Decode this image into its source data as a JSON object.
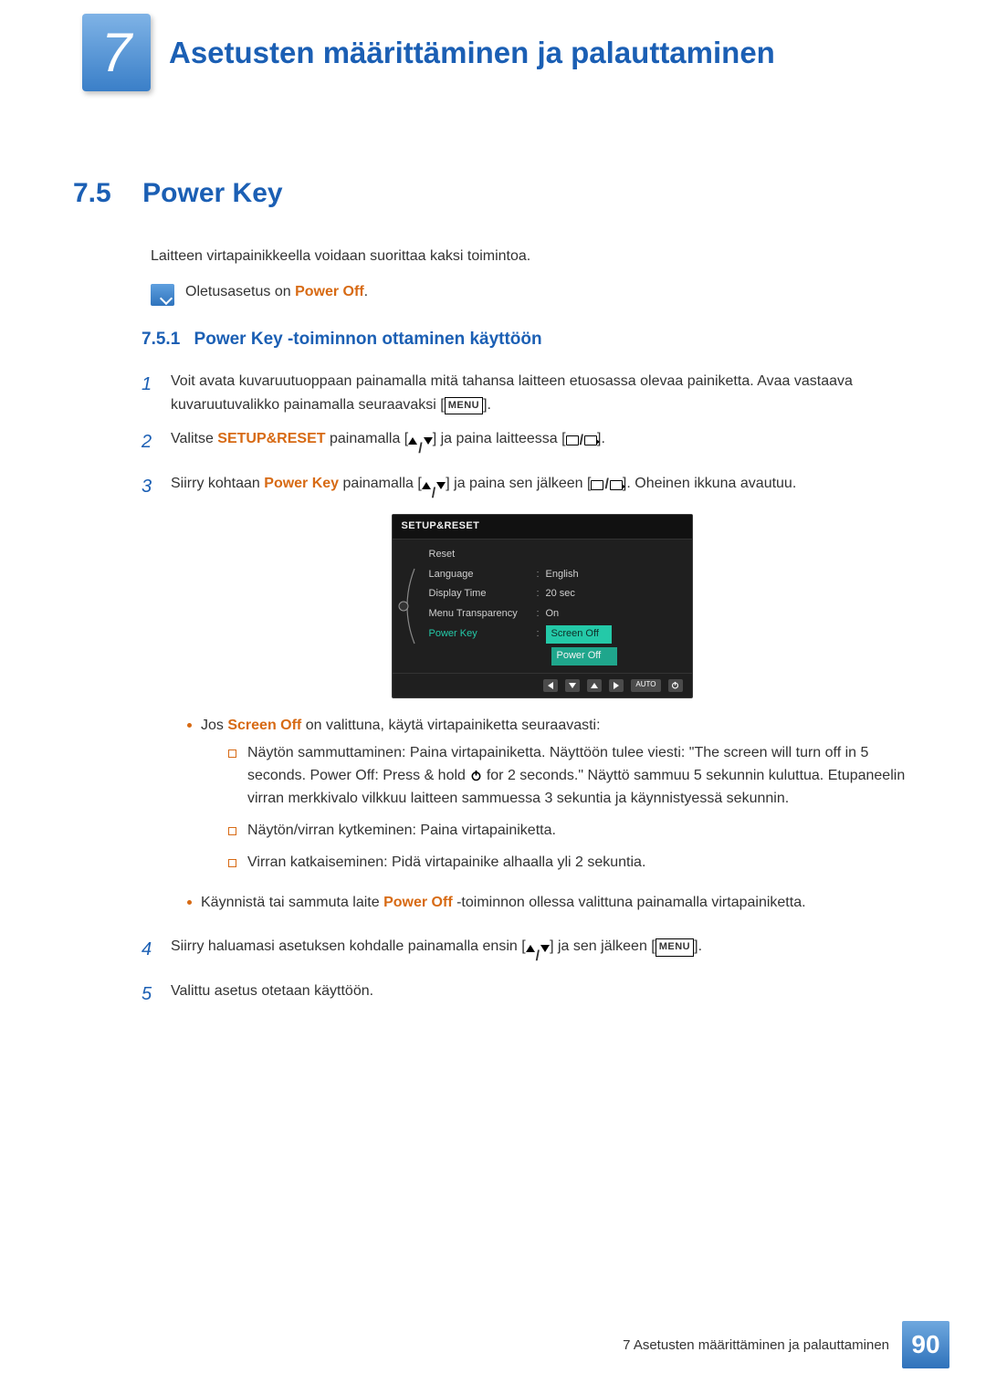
{
  "chapter": {
    "number": "7",
    "title": "Asetusten määrittäminen ja palauttaminen"
  },
  "section": {
    "number": "7.5",
    "title": "Power Key"
  },
  "intro": "Laitteen virtapainikkeella voidaan suorittaa kaksi toimintoa.",
  "note": {
    "prefix": "Oletusasetus on ",
    "highlight": "Power Off",
    "suffix": "."
  },
  "subsection": {
    "number": "7.5.1",
    "title": "Power Key -toiminnon ottaminen käyttöön"
  },
  "steps": {
    "s1": {
      "n": "1",
      "text": "Voit avata kuvaruutuoppaan painamalla mitä tahansa laitteen etuosassa olevaa painiketta. Avaa vastaava kuvaruutuvalikko painamalla seuraavaksi [",
      "after": "]."
    },
    "s2": {
      "n": "2",
      "a": "Valitse ",
      "hl": "SETUP&RESET",
      "b": " painamalla [",
      "c": "] ja paina laitteessa [",
      "d": "]."
    },
    "s3": {
      "n": "3",
      "a": "Siirry kohtaan ",
      "hl": "Power Key",
      "b": " painamalla [",
      "c": "] ja paina sen jälkeen [",
      "d": "]. Oheinen ikkuna avautuu."
    },
    "s4": {
      "n": "4",
      "a": "Siirry haluamasi asetuksen kohdalle painamalla ensin [",
      "b": "] ja sen jälkeen [",
      "c": "]."
    },
    "s5": {
      "n": "5",
      "text": "Valittu asetus otetaan käyttöön."
    }
  },
  "menu_label": "MENU",
  "osd": {
    "title": "SETUP&RESET",
    "rows": {
      "reset": "Reset",
      "language": "Language",
      "language_val": "English",
      "display_time": "Display Time",
      "display_time_val": "20 sec",
      "transparency": "Menu Transparency",
      "transparency_val": "On",
      "power_key": "Power Key",
      "opt_screen_off": "Screen Off",
      "opt_power_off": "Power Off"
    },
    "auto": "AUTO"
  },
  "bul": {
    "b1a": "Jos ",
    "b1hl": "Screen Off",
    "b1b": " on valittuna, käytä virtapainiketta seuraavasti:",
    "sq1a": "Näytön sammuttaminen: Paina virtapainiketta. Näyttöön tulee viesti: \"The screen will turn off in 5 seconds. Power Off: Press & hold ",
    "sq1b": " for 2 seconds.\" Näyttö sammuu 5 sekunnin kuluttua. Etupaneelin virran merkkivalo vilkkuu laitteen sammuessa 3 sekuntia ja käynnistyessä sekunnin.",
    "sq2": "Näytön/virran kytkeminen: Paina virtapainiketta.",
    "sq3": "Virran katkaiseminen: Pidä virtapainike alhaalla yli 2 sekuntia.",
    "b2a": "Käynnistä tai sammuta laite ",
    "b2hl": "Power Off",
    "b2b": " -toiminnon ollessa valittuna painamalla virtapainiketta."
  },
  "footer": {
    "text": "7 Asetusten määrittäminen ja palauttaminen",
    "page": "90"
  }
}
